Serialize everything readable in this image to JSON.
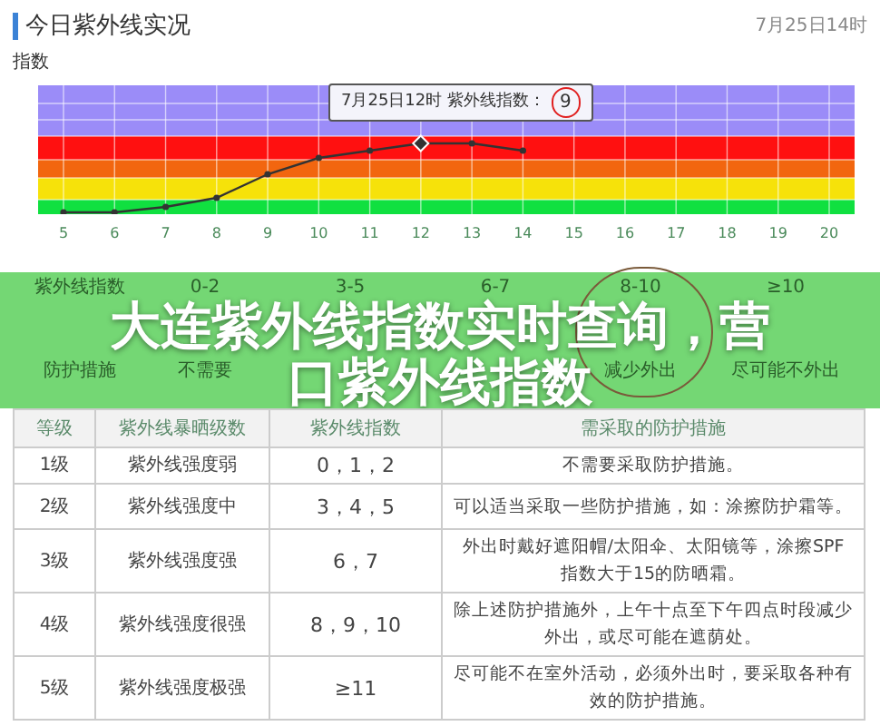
{
  "header": {
    "title": "今日紫外线实况",
    "time": "7月25日14时"
  },
  "chart": {
    "ylabel": "指数",
    "x_labels": [
      "5",
      "6",
      "7",
      "8",
      "9",
      "10",
      "11",
      "12",
      "13",
      "14",
      "15",
      "16",
      "17",
      "18",
      "19",
      "20"
    ],
    "tooltip_text": "7月25日12时 紫外线指数：",
    "tooltip_value": "9"
  },
  "legend": {
    "rows": [
      {
        "cells": [
          "紫外线指数",
          "0-2",
          "3-5",
          "6-7",
          "8-10",
          "≥10"
        ]
      },
      {
        "cells": [
          "防护措施",
          "不需要",
          "",
          "",
          "减少外出",
          "尽可能不外出"
        ]
      }
    ]
  },
  "banner": {
    "title_lines": [
      "大连紫外线指数实时查询，营",
      "口紫外线指数"
    ]
  },
  "table": {
    "columns": [
      "等级",
      "紫外线暴晒级数",
      "紫外线指数",
      "需采取的防护措施"
    ],
    "rows": [
      [
        "1级",
        "紫外线强度弱",
        "0，1，2",
        "不需要采取防护措施。"
      ],
      [
        "2级",
        "紫外线强度中",
        "3，4，5",
        "可以适当采取一些防护措施，如：涂擦防护霜等。"
      ],
      [
        "3级",
        "紫外线强度强",
        "6，7",
        "外出时戴好遮阳帽/太阳伞、太阳镜等，涂擦SPF指数大于15的防晒霜。"
      ],
      [
        "4级",
        "紫外线强度很强",
        "8，9，10",
        "除上述防护措施外，上午十点至下午四点时段减少外出，或尽可能在遮荫处。"
      ],
      [
        "5级",
        "紫外线强度极强",
        "≥11",
        "尽可能不在室外活动，必须外出时，要采取各种有效的防护措施。"
      ]
    ]
  }
}
